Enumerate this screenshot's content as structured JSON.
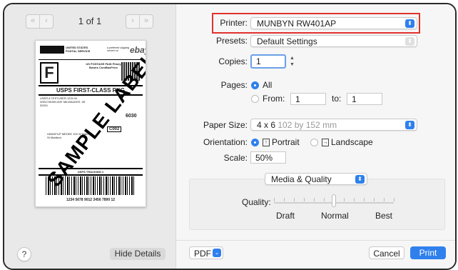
{
  "preview": {
    "page_indicator": "1 of 1",
    "nav_first": "«",
    "nav_prev": "‹",
    "nav_next": "›",
    "nav_last": "»",
    "label": {
      "usps_header": "UNITED STATES POSTAL SERVICE",
      "preferred": "a preferred shipping service on",
      "ebay": "ebay",
      "postage_paid": "US POSTAGE PAID Fitney Bowes ComBasPrice",
      "f_box": "F",
      "service": "USPS FIRST-CLASS PKG",
      "recipient": "USER A TESTUSER 1234 W. WISCONSIN AVE MILWAUKEE, WI 53201",
      "code_6030": "6030",
      "code_c002": "C002",
      "return_addr": "HANDFLIP MEDEE 100 W Main St Madison",
      "tracking_title": "USPS TRACKING #",
      "tracking_number": "1234 5678 9012 3456 7890 12",
      "watermark": "SAMPLE LABEL"
    },
    "help_label": "?",
    "hide_details_label": "Hide Details"
  },
  "settings": {
    "printer_label": "Printer:",
    "printer_value": "MUNBYN RW401AP",
    "presets_label": "Presets:",
    "presets_value": "Default Settings",
    "copies_label": "Copies:",
    "copies_value": "1",
    "pages_label": "Pages:",
    "pages_all": "All",
    "pages_from": "From:",
    "pages_from_value": "1",
    "pages_to": "to:",
    "pages_to_value": "1",
    "paper_size_label": "Paper Size:",
    "paper_size_value": "4 x 6",
    "paper_size_dims": "102 by 152 mm",
    "orientation_label": "Orientation:",
    "orientation_portrait": "Portrait",
    "orientation_landscape": "Landscape",
    "scale_label": "Scale:",
    "scale_value": "50%",
    "section_value": "Media & Quality",
    "quality_label": "Quality:",
    "quality_draft": "Draft",
    "quality_normal": "Normal",
    "quality_best": "Best",
    "quality_level": 0.5
  },
  "footer": {
    "pdf_label": "PDF",
    "cancel_label": "Cancel",
    "print_label": "Print"
  },
  "colors": {
    "accent": "#2f80ed",
    "highlight": "#e0322c"
  }
}
